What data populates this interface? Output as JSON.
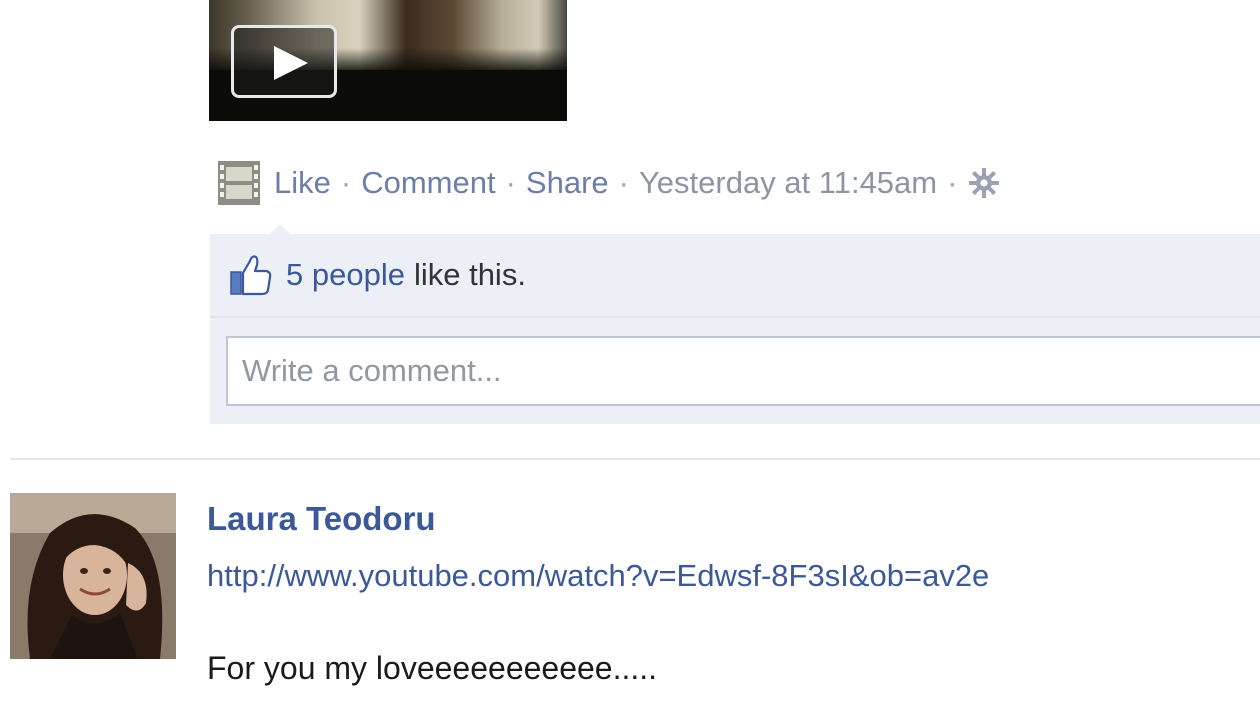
{
  "post_1": {
    "video": {
      "play_icon": "play-icon"
    },
    "actions": {
      "type_icon": "film-icon",
      "like": "Like",
      "separator": "·",
      "comment": "Comment",
      "share": "Share",
      "timestamp": "Yesterday at 11:45am",
      "settings_icon": "gear-icon"
    },
    "likes": {
      "icon": "thumbs-up-icon",
      "people_link": "5 people",
      "rest": "like this."
    },
    "comment_box": {
      "placeholder": "Write a comment..."
    }
  },
  "post_2": {
    "author": "Laura Teodoru",
    "link": "http://www.youtube.com/watch?v=Edwsf-8F3sI&ob=av2e",
    "message": "For you my loveeeeeeeeeee....."
  },
  "colors": {
    "link_blue": "#3b5998",
    "ufi_background": "#eceff5",
    "muted_text": "#8a93a6"
  }
}
